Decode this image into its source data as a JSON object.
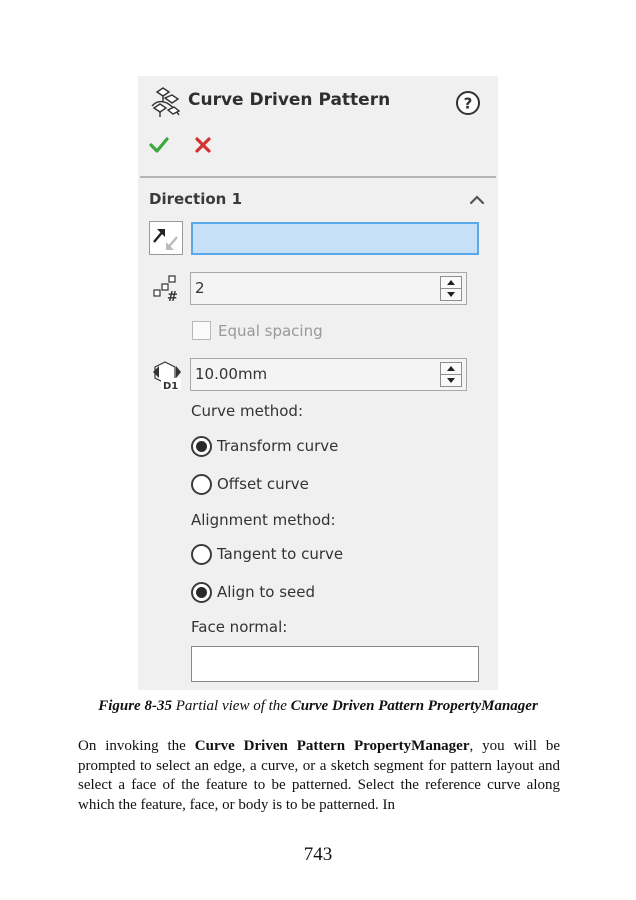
{
  "panel": {
    "title": "Curve Driven Pattern",
    "section_title": "Direction 1",
    "instance_count": "2",
    "equal_spacing_label": "Equal spacing",
    "spacing_value": "10.00mm",
    "curve_method_label": "Curve method:",
    "curve_method_options": [
      "Transform curve",
      "Offset curve"
    ],
    "curve_method_selected": "Transform curve",
    "alignment_method_label": "Alignment method:",
    "alignment_method_options": [
      "Tangent to curve",
      "Align to seed"
    ],
    "alignment_method_selected": "Align to seed",
    "face_normal_label": "Face normal:",
    "spacing_icon_text": "D1",
    "colors": {
      "accept": "#3aa83a",
      "cancel": "#d63030",
      "selection_fill": "#c6e0f7",
      "selection_border": "#5aa8ea",
      "panel_bg": "#f0f0f0"
    },
    "icons": [
      "curve-driven-pattern-icon",
      "help-icon",
      "ok-check-icon",
      "cancel-x-icon",
      "collapse-chevron-icon",
      "reverse-direction-icon",
      "instances-icon",
      "spacing-icon"
    ]
  },
  "caption": {
    "number": "Figure 8-35",
    "text": "Partial view of the",
    "emphasis": "Curve Driven Pattern PropertyManager"
  },
  "body": {
    "lead": "On invoking the",
    "emphasis": "Curve Driven Pattern PropertyManager",
    "text": ", you will be prompted to select an edge, a curve, or a sketch segment for pattern layout and select a face of the feature to be patterned. Select the reference curve along which the feature, face, or body is to be patterned. In"
  },
  "page_number": "743"
}
